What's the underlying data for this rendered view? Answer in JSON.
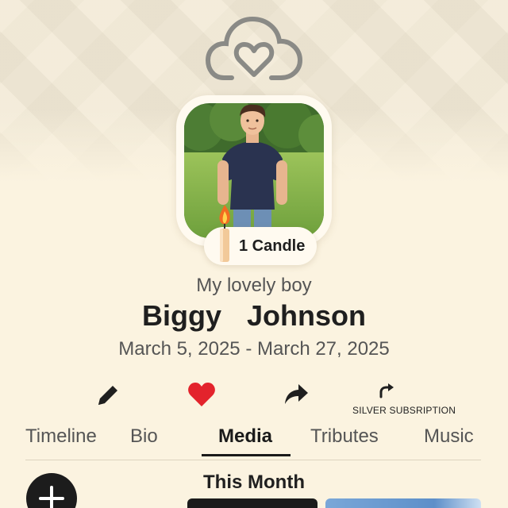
{
  "app": {
    "logo_icon": "cloud-heart-icon"
  },
  "profile": {
    "photo_alt": "Profile photo",
    "candles": {
      "label": "1 Candle",
      "icon": "candle-icon"
    },
    "subtitle": "My lovely boy",
    "name": "Biggy  Johnson",
    "dates": "March 5, 2025 - March 27, 2025"
  },
  "actions": {
    "edit_icon": "pencil-icon",
    "like_icon": "heart-icon",
    "share_icon": "share-arrow-icon",
    "subscription_icon": "redo-arrow-icon",
    "subscription_label": "SILVER SUBSRIPTION"
  },
  "tabs": [
    {
      "label": "Timeline",
      "active": false
    },
    {
      "label": "Bio",
      "active": false
    },
    {
      "label": "Media",
      "active": true
    },
    {
      "label": "Tributes",
      "active": false
    },
    {
      "label": "Music",
      "active": false
    }
  ],
  "media": {
    "add_icon": "plus-icon",
    "section_title": "This Month"
  },
  "colors": {
    "background": "#fbf3e0",
    "heart": "#e3232c",
    "text_dark": "#1f1f1f",
    "text_muted": "#555555"
  }
}
